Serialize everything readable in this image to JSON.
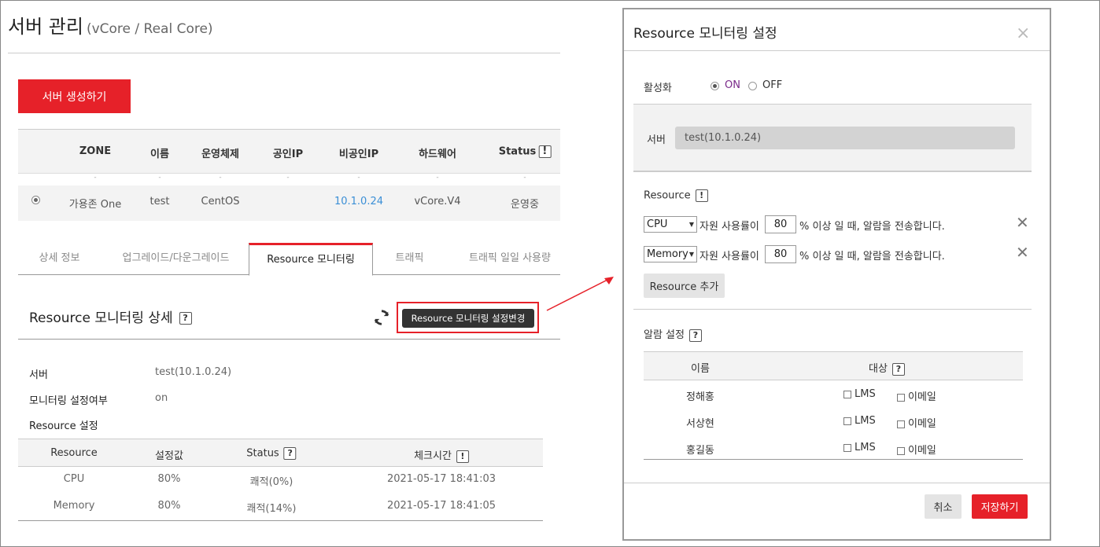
{
  "page": {
    "title": "서버 관리",
    "subtitle": "(vCore / Real Core)",
    "create_button": "서버 생성하기"
  },
  "server_table": {
    "headers": [
      "ZONE",
      "이름",
      "운영체제",
      "공인IP",
      "비공인IP",
      "하드웨어",
      "Status"
    ],
    "status_badge": "!",
    "dots": [
      "-",
      "-",
      "-",
      "-",
      "-",
      "-",
      "-"
    ],
    "rows": [
      {
        "zone": "가용존 One",
        "name": "test",
        "os": "CentOS",
        "public_ip": "",
        "private_ip": "10.1.0.24",
        "hardware": "vCore.V4",
        "status": "운영중"
      }
    ]
  },
  "tabs": [
    "상세 정보",
    "업그레이드/다운그레이드",
    "Resource 모니터링",
    "트래픽",
    "트래픽 일일 사용량"
  ],
  "active_tab": "Resource 모니터링",
  "detail": {
    "title": "Resource 모니터링 상세",
    "help_badge": "?",
    "settings_button": "Resource 모니터링 설정변경",
    "fields": [
      {
        "label": "서버",
        "value": "test(10.1.0.24)"
      },
      {
        "label": "모니터링 설정여부",
        "value": "on"
      },
      {
        "label": "Resource 설정",
        "value": ""
      }
    ]
  },
  "resource_table": {
    "headers": [
      "Resource",
      "설정값",
      "Status",
      "체크시간"
    ],
    "status_badge": "?",
    "time_badge": "!",
    "rows": [
      {
        "resource": "CPU",
        "value": "80%",
        "status": "쾌적(0%)",
        "time": "2021-05-17 18:41:03"
      },
      {
        "resource": "Memory",
        "value": "80%",
        "status": "쾌적(14%)",
        "time": "2021-05-17 18:41:05"
      }
    ]
  },
  "modal": {
    "title": "Resource 모니터링 설정",
    "close_icon": "×",
    "activation_label": "활성화",
    "on_label": "ON",
    "off_label": "OFF",
    "activation_value": "ON",
    "server_label": "서버",
    "server_value": "test(10.1.0.24)",
    "resource_label": "Resource",
    "resource_badge": "!",
    "resource_rules": [
      {
        "resource": "CPU",
        "text_before": "자원 사용률이",
        "threshold": "80",
        "text_after": "% 이상 일 때, 알람을 전송합니다."
      },
      {
        "resource": "Memory",
        "text_before": "자원 사용률이",
        "threshold": "80",
        "text_after": "% 이상 일 때, 알람을 전송합니다."
      }
    ],
    "add_resource_button": "Resource 추가",
    "alarm_label": "알람 설정",
    "alarm_badge": "?",
    "alarm_headers": [
      "이름",
      "대상"
    ],
    "alarm_target_badge": "?",
    "lms_label": "LMS",
    "email_label": "이메일",
    "alarm_rows": [
      {
        "name": "정해홍"
      },
      {
        "name": "서상현"
      },
      {
        "name": "홍길동"
      }
    ],
    "cancel_button": "취소",
    "save_button": "저장하기"
  },
  "colors": {
    "accent": "#e62129",
    "link": "#3b8fd6",
    "dark_button": "#333333",
    "on_label": "#7a2a8a"
  }
}
